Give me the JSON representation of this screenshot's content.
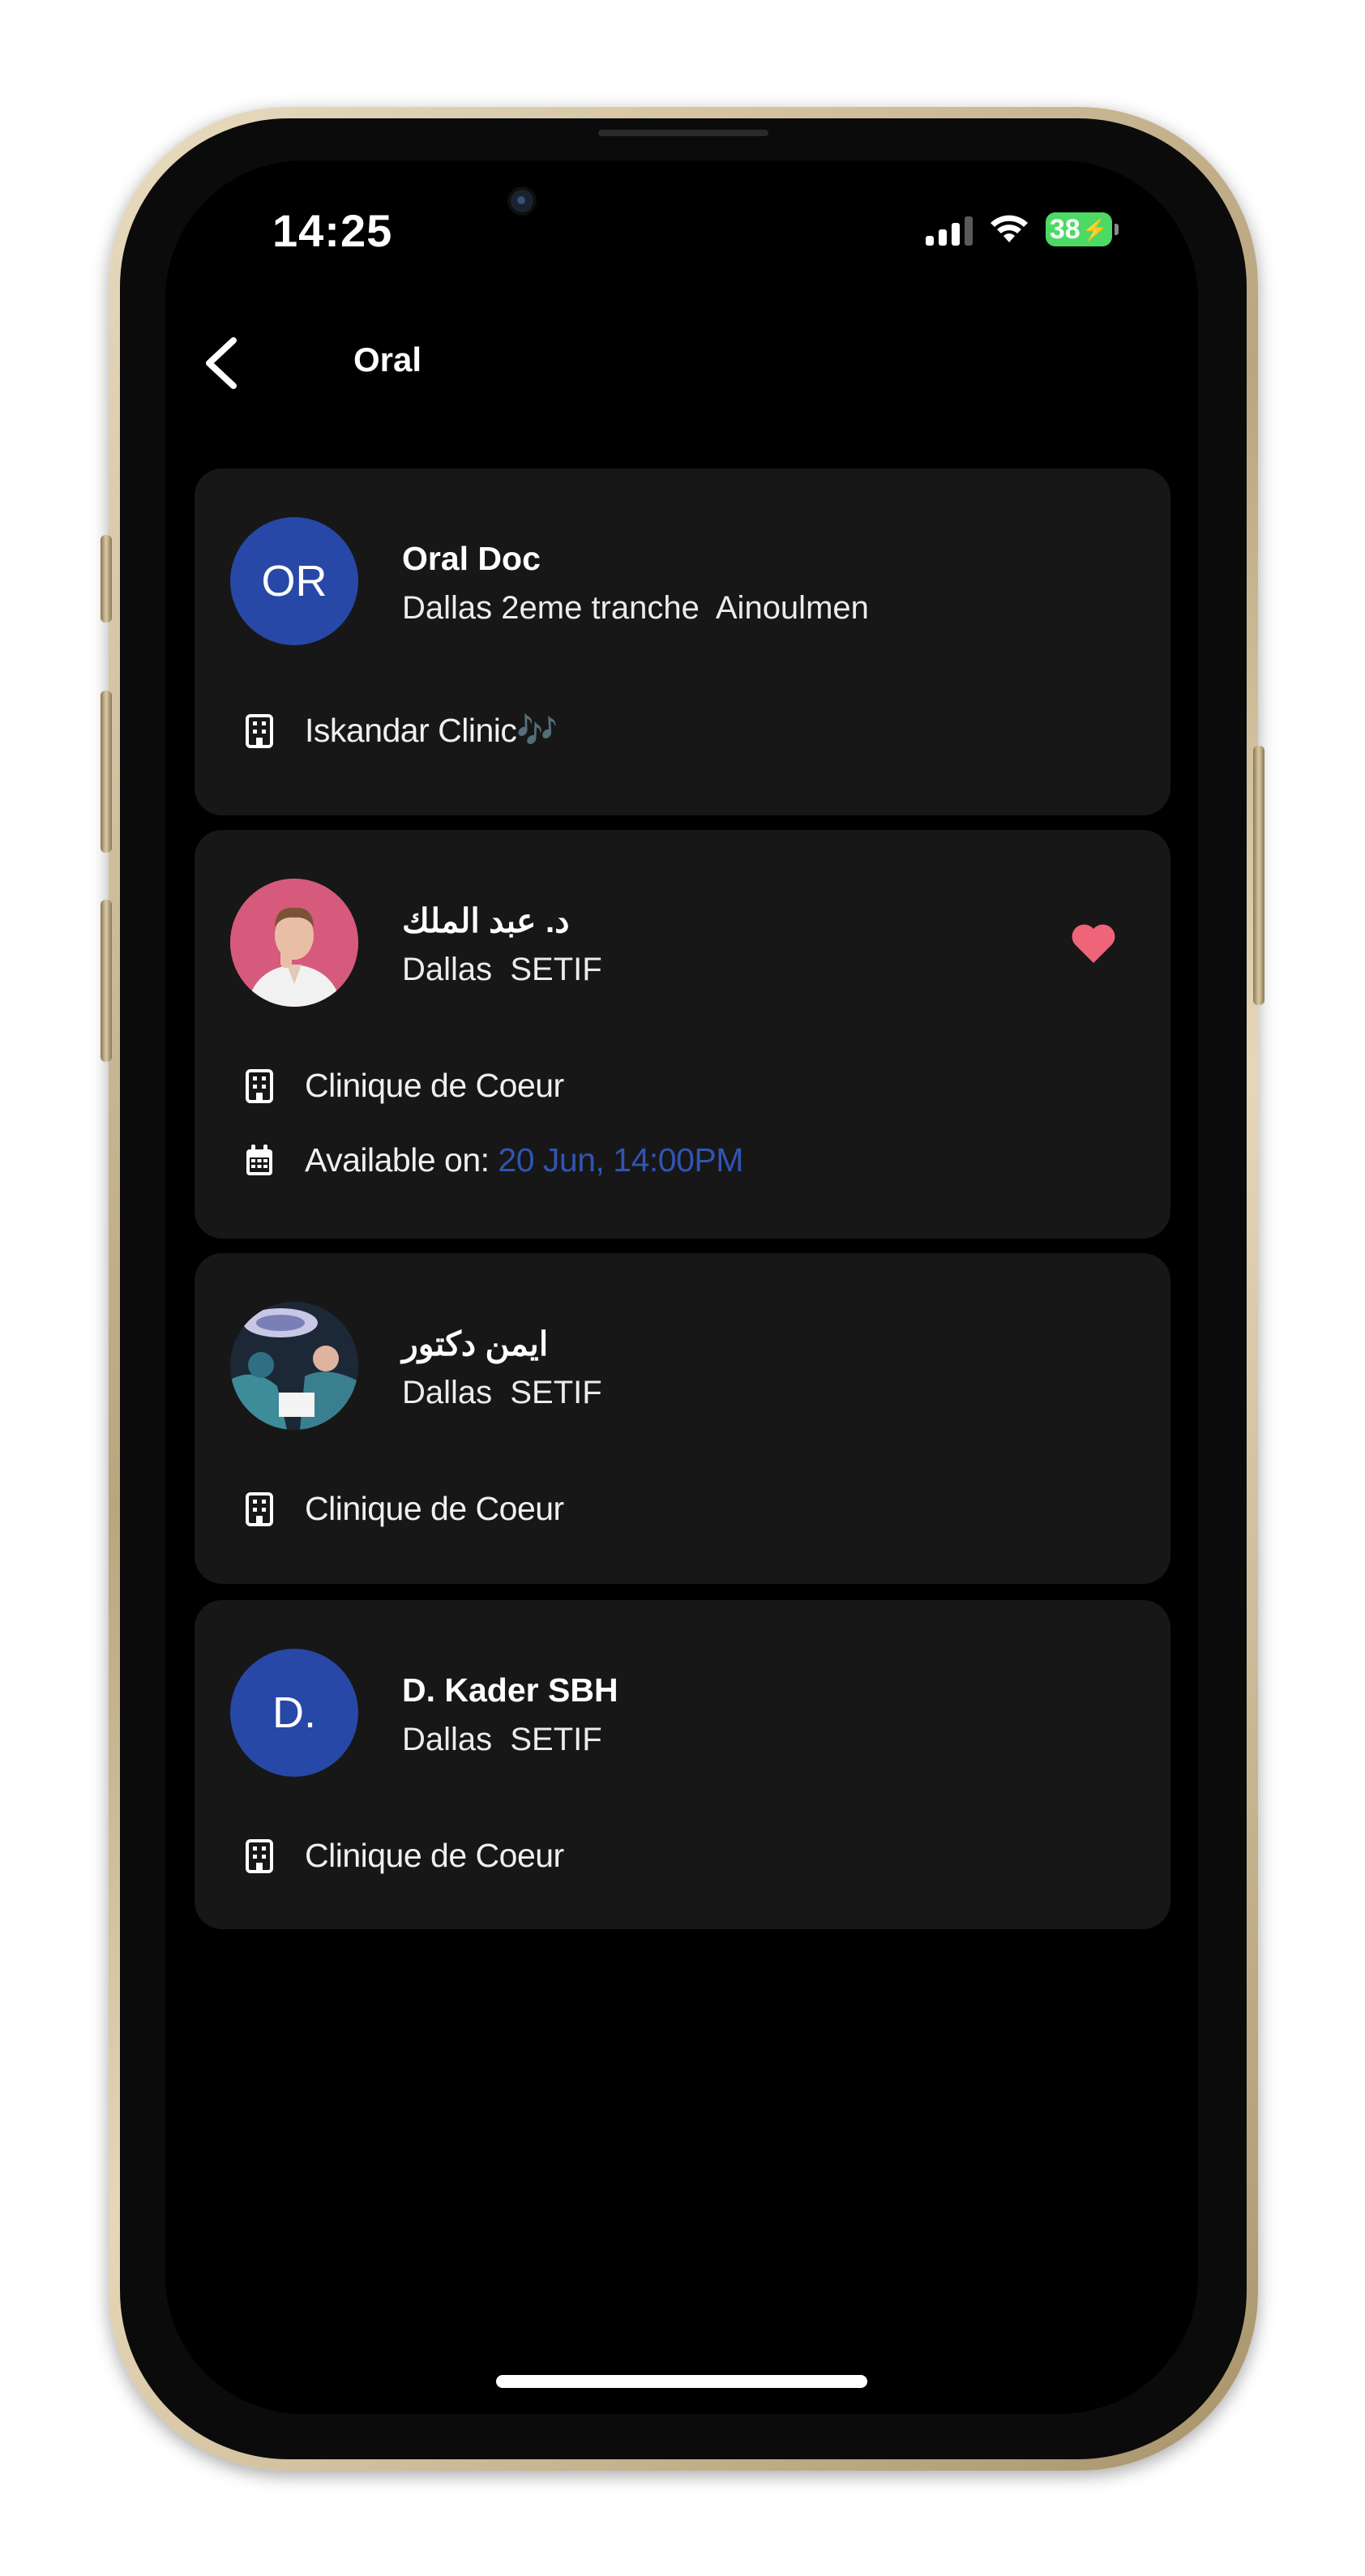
{
  "status_bar": {
    "time": "14:25",
    "battery": "38"
  },
  "header": {
    "title": "Oral"
  },
  "doctors": [
    {
      "avatar_initials": "OR",
      "name": "Oral Doc",
      "address": "Dallas 2eme tranche  Ainoulmen",
      "clinic": "Iskandar Clinic🎶"
    },
    {
      "name": "د. عبد الملك",
      "address": "Dallas  SETIF",
      "clinic": "Clinique de Coeur",
      "availability_label": "Available on: ",
      "availability_value": "20 Jun, 14:00PM",
      "favorite": true
    },
    {
      "name": "ايمن دكتور",
      "address": "Dallas  SETIF",
      "clinic": "Clinique de Coeur"
    },
    {
      "avatar_initials": "D.",
      "name": "D. Kader SBH",
      "address": "Dallas  SETIF",
      "clinic": "Clinique de Coeur"
    }
  ],
  "colors": {
    "background": "#000000",
    "card": "#171717",
    "avatar": "#2748a6",
    "accent": "#3254b2",
    "favorite": "#f0647a"
  },
  "icons": [
    "back-chevron-icon",
    "building-icon",
    "calendar-icon",
    "heart-icon",
    "signal-icon",
    "wifi-icon",
    "battery-icon"
  ]
}
